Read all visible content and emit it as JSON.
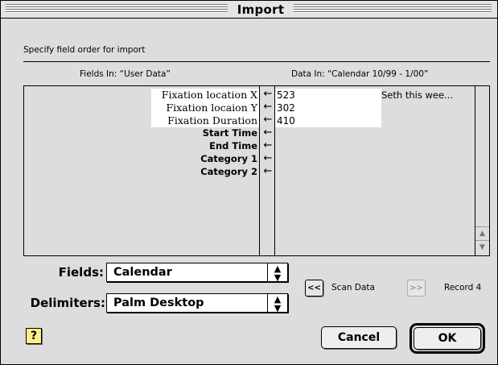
{
  "window": {
    "title": "Import"
  },
  "instruction": "Specify field order for import",
  "fields_in_label": "Fields In: “User Data”",
  "data_in_label": "Data In: “Calendar 10/99 - 1/00”",
  "mapping": {
    "fields": [
      "Fixation location X",
      "Fixation locaion Y",
      "Fixation Duration",
      "Start Time",
      "End Time",
      "Category 1",
      "Category 2"
    ],
    "arrow": "←",
    "data_values": [
      "523",
      "302",
      "410"
    ],
    "data_extra": "Seth this wee..."
  },
  "fields_popup": {
    "label": "Fields:",
    "value": "Calendar"
  },
  "delimiters_popup": {
    "label": "Delimiters:",
    "value": "Palm Desktop"
  },
  "scan_data": {
    "button": "<<",
    "label": "Scan Data"
  },
  "record": {
    "button": ">>",
    "label": "Record 4"
  },
  "help_button": "?",
  "cancel_button": "Cancel",
  "ok_button": "OK"
}
